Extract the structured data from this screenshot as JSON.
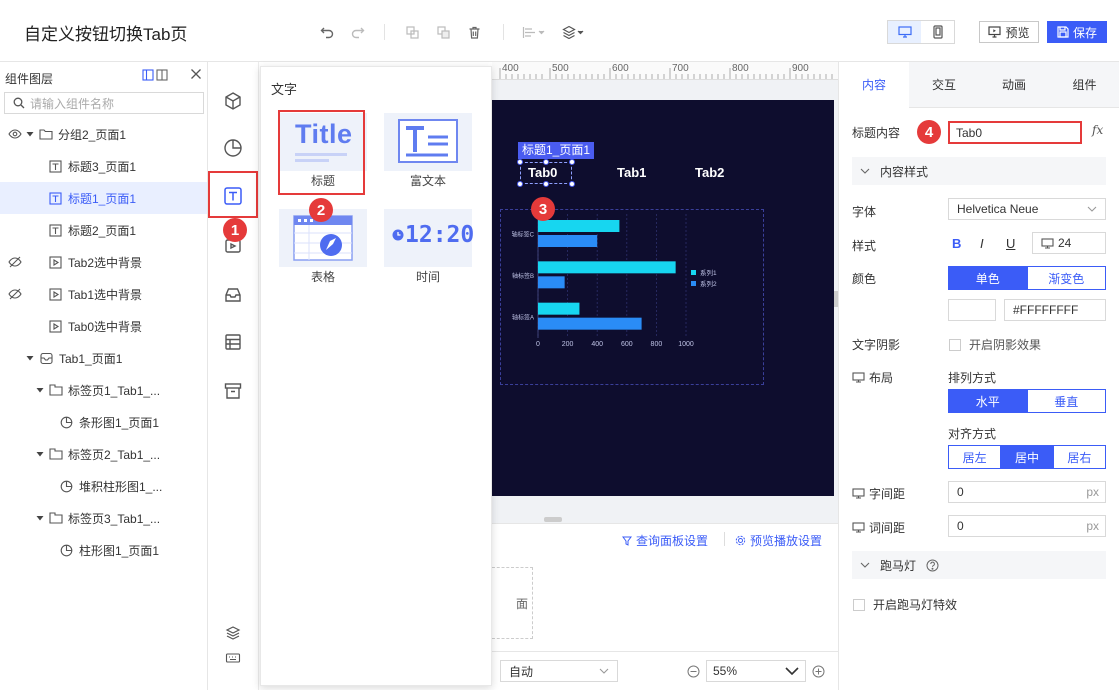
{
  "header": {
    "title": "自定义按钮切换Tab页",
    "preview_label": "预览",
    "save_label": "保存"
  },
  "layers": {
    "title": "组件图层",
    "search_placeholder": "请输入组件名称",
    "items": [
      {
        "label": "分组2_页面1",
        "icon": "folder-icon"
      },
      {
        "label": "标题3_页面1",
        "icon": "text-icon"
      },
      {
        "label": "标题1_页面1",
        "icon": "text-icon"
      },
      {
        "label": "标题2_页面1",
        "icon": "text-icon"
      },
      {
        "label": "Tab2选中背景",
        "icon": "image-icon"
      },
      {
        "label": "Tab1选中背景",
        "icon": "image-icon"
      },
      {
        "label": "Tab0选中背景",
        "icon": "image-icon"
      },
      {
        "label": "Tab1_页面1",
        "icon": "tab-icon"
      },
      {
        "label": "标签页1_Tab1_...",
        "icon": "tab-page-icon"
      },
      {
        "label": "条形图1_页面1",
        "icon": "chart-icon"
      },
      {
        "label": "标签页2_Tab1_...",
        "icon": "tab-page-icon"
      },
      {
        "label": "堆积柱形图1_...",
        "icon": "chart-icon"
      },
      {
        "label": "标签页3_Tab1_...",
        "icon": "tab-page-icon"
      },
      {
        "label": "柱形图1_页面1",
        "icon": "chart-icon"
      }
    ]
  },
  "flyout": {
    "title": "文字",
    "items": [
      {
        "label": "标题",
        "preview": "Title"
      },
      {
        "label": "富文本",
        "preview": ""
      },
      {
        "label": "表格",
        "preview": ""
      },
      {
        "label": "时间",
        "preview": "12:20"
      }
    ]
  },
  "canvas": {
    "ruler_ticks": [
      "400",
      "500",
      "600",
      "700",
      "800",
      "900"
    ],
    "selected_tag": "标题1_页面1",
    "tabs": [
      "Tab0",
      "Tab1",
      "Tab2"
    ],
    "query_panel_label": "查询面板设置",
    "playback_label": "预览播放设置",
    "panel_text": "面",
    "auto_label": "自动",
    "zoom_label": "55%"
  },
  "chart_data": {
    "type": "bar",
    "orientation": "horizontal",
    "categories": [
      "轴标签A",
      "轴标签B",
      "轴标签C"
    ],
    "series": [
      {
        "name": "系列1",
        "values": [
          280,
          930,
          550
        ],
        "color": "#17d6f0"
      },
      {
        "name": "系列2",
        "values": [
          700,
          180,
          400
        ],
        "color": "#2a8cf6"
      }
    ],
    "xticks": [
      "0",
      "200",
      "400",
      "600",
      "800",
      "1000"
    ],
    "xlim": [
      0,
      1000
    ],
    "legend_position": "right",
    "grid": true
  },
  "props": {
    "tabs": [
      "内容",
      "交互",
      "动画",
      "组件"
    ],
    "title_content_label": "标题内容",
    "title_content_value": "Tab0",
    "fx_label": "fx",
    "content_style_label": "内容样式",
    "font_label": "字体",
    "font_value": "Helvetica Neue",
    "style_label": "样式",
    "bold_label": "B",
    "italic_label": "I",
    "underline_label": "U",
    "font_size": "24",
    "color_label": "颜色",
    "color_single": "单色",
    "color_gradient": "渐变色",
    "color_value": "#FFFFFFFF",
    "shadow_label": "文字阴影",
    "shadow_option": "开启阴影效果",
    "layout_label": "布局",
    "arrange_label": "排列方式",
    "arrange_h": "水平",
    "arrange_v": "垂直",
    "align_label": "对齐方式",
    "align_left": "居左",
    "align_center": "居中",
    "align_right": "居右",
    "letter_spacing_label": "字间距",
    "letter_spacing_value": "0",
    "word_spacing_label": "词间距",
    "word_spacing_value": "0",
    "px_unit": "px",
    "marquee_label": "跑马灯",
    "marquee_option": "开启跑马灯特效"
  },
  "badges": [
    "1",
    "2",
    "3",
    "4"
  ],
  "colors": {
    "accent": "#3b5cf7",
    "stage": "#0e0d2e",
    "badge": "#e53a3a"
  }
}
